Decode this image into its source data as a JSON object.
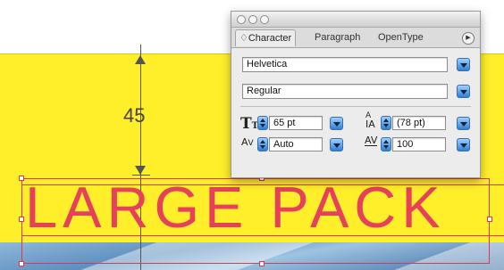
{
  "panel": {
    "tabs": [
      {
        "label": "♢Character",
        "active": true
      },
      {
        "label": "Paragraph",
        "active": false
      },
      {
        "label": "OpenType",
        "active": false
      }
    ],
    "menu_icon": "▶",
    "font_family": "Helvetica",
    "font_style": "Regular",
    "font_size": "65 pt",
    "leading": "(78 pt)",
    "kerning": "Auto",
    "tracking": "100"
  },
  "artboard": {
    "headline": "LARGE PACK",
    "measurement": "45"
  },
  "colors": {
    "background_yellow": "#ffef2b",
    "headline_red": "#e6405a",
    "selection_red": "#d93a52",
    "accent_blue": "#2f7fd6"
  },
  "icons": {
    "font_size_icon": "font-size-icon",
    "leading_icon": "leading-icon",
    "kerning_icon": "kerning-icon",
    "tracking_icon": "tracking-icon"
  }
}
